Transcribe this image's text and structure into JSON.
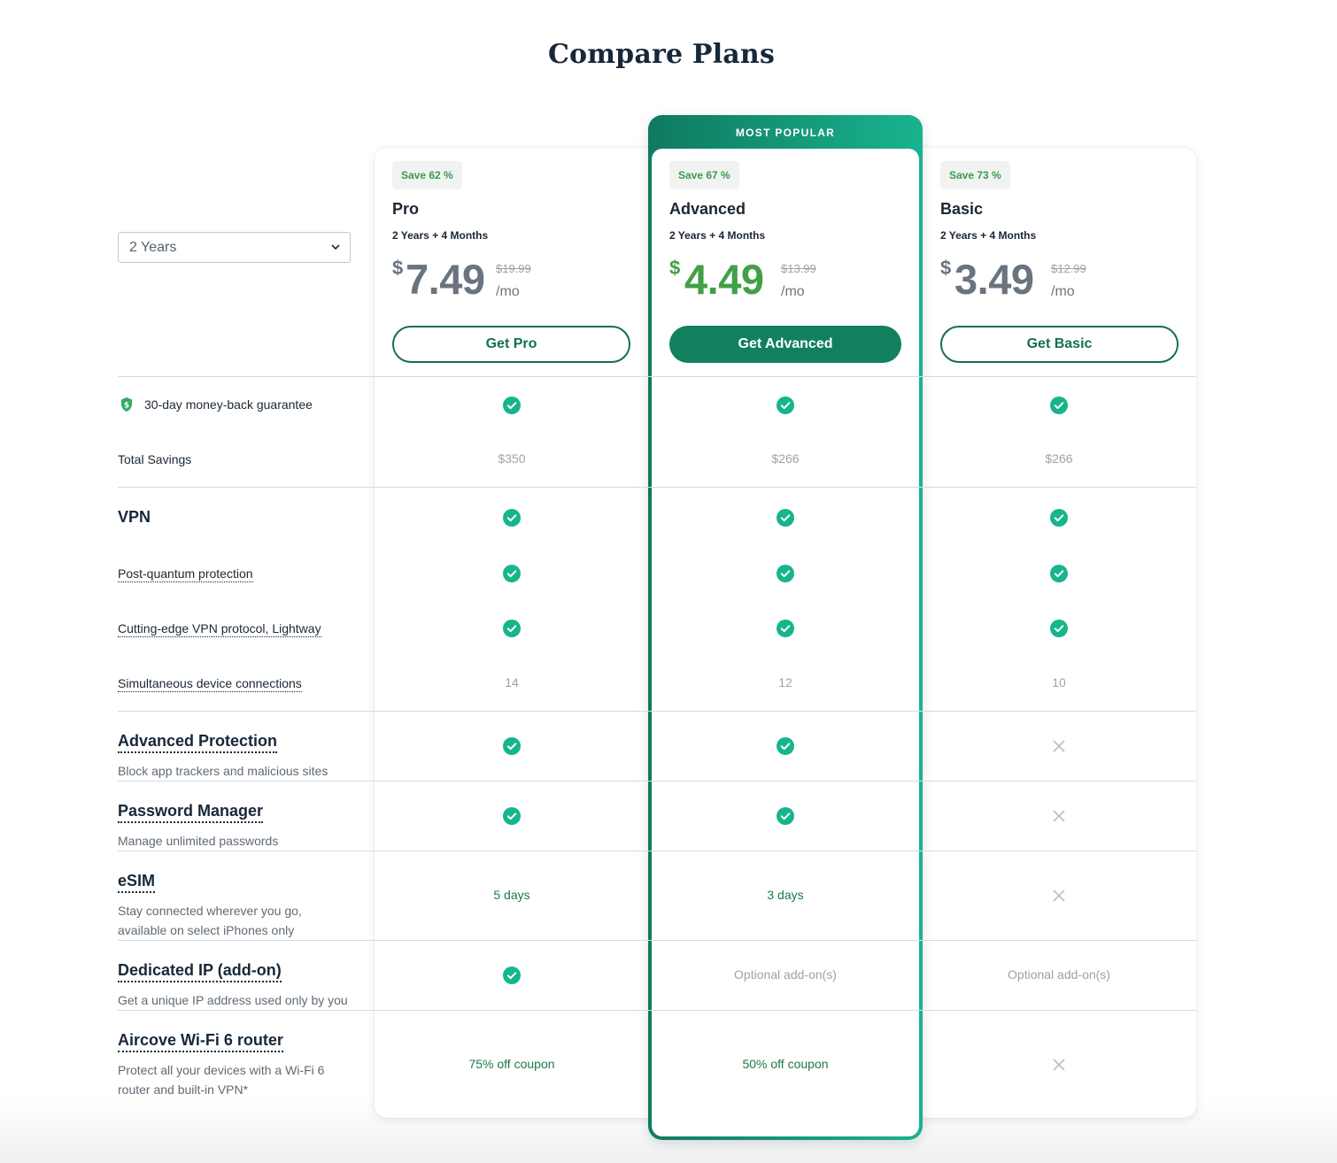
{
  "page": {
    "title": "Compare Plans"
  },
  "duration_select": {
    "value": "2 Years"
  },
  "plans": [
    {
      "key": "pro",
      "save": "Save 62 %",
      "name": "Pro",
      "term": "2 Years + 4 Months",
      "currency": "$",
      "price": "7.49",
      "old_price": "$19.99",
      "per": "/mo",
      "button": "Get Pro"
    },
    {
      "key": "advanced",
      "badge": "MOST POPULAR",
      "save": "Save 67 %",
      "name": "Advanced",
      "term": "2 Years + 4 Months",
      "currency": "$",
      "price": "4.49",
      "old_price": "$13.99",
      "per": "/mo",
      "button": "Get Advanced"
    },
    {
      "key": "basic",
      "save": "Save 73 %",
      "name": "Basic",
      "term": "2 Years + 4 Months",
      "currency": "$",
      "price": "3.49",
      "old_price": "$12.99",
      "per": "/mo",
      "button": "Get Basic"
    }
  ],
  "rows": {
    "guarantee": {
      "label": "30-day money-back guarantee",
      "values": [
        "check",
        "check",
        "check"
      ]
    },
    "savings": {
      "label": "Total Savings",
      "values": [
        "$350",
        "$266",
        "$266"
      ]
    },
    "vpn": {
      "label": "VPN",
      "values": [
        "check",
        "check",
        "check"
      ]
    },
    "pq": {
      "label": "Post-quantum protection",
      "values": [
        "check",
        "check",
        "check"
      ]
    },
    "lightway": {
      "label": "Cutting-edge VPN protocol, Lightway",
      "values": [
        "check",
        "check",
        "check"
      ]
    },
    "devices": {
      "label": "Simultaneous device connections",
      "values": [
        "14",
        "12",
        "10"
      ]
    },
    "advprot": {
      "label": "Advanced Protection",
      "desc": "Block app trackers and malicious sites",
      "values": [
        "check",
        "check",
        "cross"
      ]
    },
    "pwm": {
      "label": "Password Manager",
      "desc": "Manage unlimited passwords",
      "values": [
        "check",
        "check",
        "cross"
      ]
    },
    "esim": {
      "label": "eSIM",
      "desc": "Stay connected wherever you go, available on select iPhones only",
      "values": [
        "5 days",
        "3 days",
        "cross"
      ]
    },
    "dip": {
      "label": "Dedicated IP (add-on)",
      "desc": "Get a unique IP address used only by you",
      "values": [
        "check",
        "Optional add-on(s)",
        "Optional add-on(s)"
      ]
    },
    "router": {
      "label": "Aircove Wi-Fi 6 router",
      "desc": "Protect all your devices with a Wi-Fi 6 router and built-in VPN*",
      "values": [
        "75% off coupon",
        "50% off coupon",
        "cross"
      ]
    }
  },
  "icons": {
    "check": "check-circle-icon",
    "cross": "close-icon",
    "shield": "shield-dollar-icon",
    "chevron": "chevron-down-icon"
  },
  "colors": {
    "accent": "#12805f",
    "check": "#17b58c",
    "price_highlight": "#43a047"
  }
}
